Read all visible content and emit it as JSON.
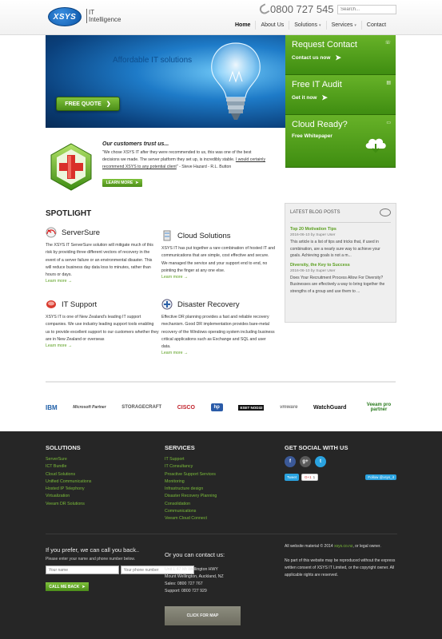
{
  "header": {
    "logo_text": "XSYS",
    "tagline_line1": "IT",
    "tagline_line2": "Intelligence",
    "phone": "0800 727 545",
    "search_placeholder": "Search..."
  },
  "nav": [
    {
      "label": "Home",
      "caret": ""
    },
    {
      "label": "About Us",
      "caret": ""
    },
    {
      "label": "Solutions",
      "caret": "▾"
    },
    {
      "label": "Services",
      "caret": "▾"
    },
    {
      "label": "Contact",
      "caret": ""
    }
  ],
  "hero": {
    "title": "Affordable IT solutions",
    "button": "FREE QUOTE",
    "button_arrow": "❯"
  },
  "panels": [
    {
      "title": "Request Contact",
      "sub": "Contact us now",
      "icon": "phone-icon"
    },
    {
      "title": "Free IT Audit",
      "sub": "Get it now",
      "icon": "audit-icon"
    },
    {
      "title": "Cloud Ready?",
      "sub": "Free Whitepaper",
      "icon": "cloud-download-icon"
    }
  ],
  "testimonial": {
    "title": "Our customers trust us...",
    "body": "\"We chose XSYS IT after they were recommended to us, this was one of the best decisions we made. The server platform they set up, is incredibly stable.",
    "link": "I would certainly recommend XSYS to any potential client",
    "author": "\" - Steve Hazard - R.L. Button",
    "button": "LEARN MORE"
  },
  "spotlight": {
    "title": "SPOTLIGHT",
    "items": [
      {
        "title": "ServerSure",
        "body": "The XSYS IT ServerSure solution will mitigate much of this risk by providing three different vectors of recovery in the event of a server failure or an environmental disaster. This will reduce business day data loss to minutes, rather than hours or days.",
        "more": "Learn more →"
      },
      {
        "title": "Cloud Solutions",
        "body": "XSYS IT has put together a rare combination of hosted IT and communications that are simple, cost effective and secure. We managed the service and your support end to end, no pointing the finger at any one else.",
        "more": "Learn more →"
      },
      {
        "title": "IT Support",
        "body": "XSYS IT is one of New Zealand's leading IT support companies. We use industry leading support tools enabling us to provide excellent support to our customers whether they are in New Zealand or overseas",
        "more": "Learn more →"
      },
      {
        "title": "Disaster Recovery",
        "body": "Effective DR planning provides a fast and reliable recovery mechanism. Good DR implementation provides bare-metal recovery of the Windows operating system including business critical applications such as Exchange and SQL and user data.",
        "more": "Learn more →"
      }
    ]
  },
  "blog": {
    "title": "LATEST BLOG POSTS",
    "posts": [
      {
        "title": "Top 20 Motivation Tips",
        "meta": "2016-06-10 by Super User",
        "body": "This article is a list of tips and tricks that, if used in combination, are a nearly sure way to achieve your goals. Achieving goals is not a m..."
      },
      {
        "title": "Diversity, the Key to Success",
        "meta": "2016-06-10 by Super User",
        "body": "Does Your Recruitment Process Allow For Diversity? Businesses are effectively a way to bring together the strengths of a group and use them to ..."
      }
    ]
  },
  "partners": [
    "IBM",
    "Microsoft Partner",
    "STORAGECRAFT",
    "CISCO",
    "hp",
    "ESET NOD32",
    "vmware",
    "WatchGuard",
    "Veeam pro partner"
  ],
  "footer": {
    "solutions_head": "SOLUTIONS",
    "solutions": [
      "ServerSure",
      "ICT Bundle",
      "Cloud Solutions",
      "Unified Communications",
      "Hosted IP Telephony",
      "Virtualization",
      "Veeam DR Solutions"
    ],
    "services_head": "SERVICES",
    "services": [
      "IT Support",
      "IT Consultancy",
      "Proactive Support Services",
      "Monitoring",
      "Infrastructure design",
      "Disaster Recovery Planning",
      "Consolidation",
      "Communications",
      "Veeam Cloud Connect"
    ],
    "social_head": "GET SOCIAL WITH US",
    "social": [
      {
        "label": "f",
        "color": "#3b5998"
      },
      {
        "label": "g+",
        "color": "#5a5a5a"
      },
      {
        "label": "t",
        "color": "#2aa3e0"
      }
    ],
    "tweet": "Tweet",
    "gplus": "G+1",
    "gplus_count": "1",
    "follow": "Follow @xsys_it",
    "callback_head": "If you prefer, we can call you back..",
    "callback_sub": "Please enter your name and phone number below.",
    "name_placeholder": "Your name",
    "phone_placeholder": "Your phone number",
    "callback_button": "CALL ME BACK",
    "contact_head": "Or you can contact us:",
    "contact_lines": [
      "Unit L 47 Mt Wellington HWY",
      "Mount Wellington, Auckland, NZ",
      "Sales: 0800 727 767",
      "Support: 0800 727 929"
    ],
    "map_button": "CLICK FOR MAP",
    "legal_a": "All website material © 2014",
    "legal_site": "xsys.co.nz",
    "legal_b": ", or legal owner.",
    "legal_c": "No part of this website may be reproduced without the express written consent of XSYS IT Limited, or the copyright owner. All applicable rights are reserved."
  }
}
